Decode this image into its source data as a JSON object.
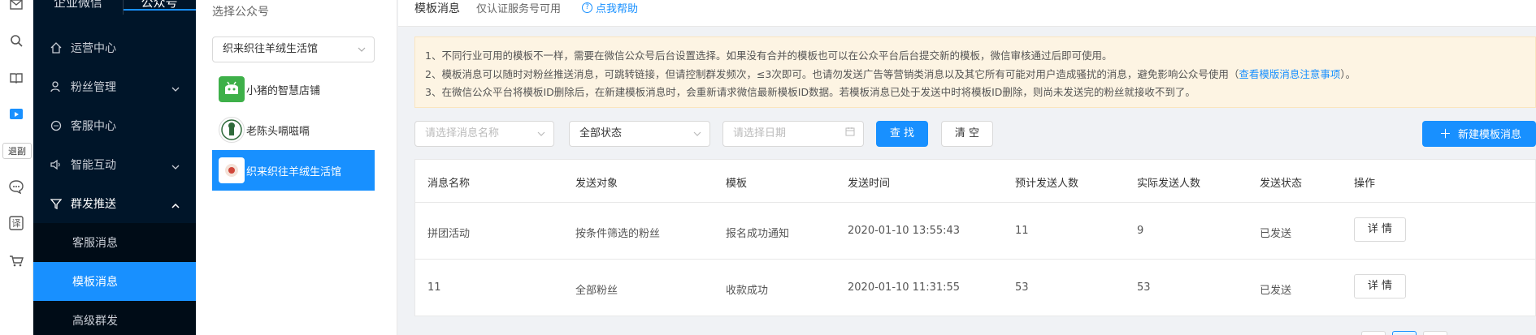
{
  "rail": {
    "icons": [
      "mail-icon",
      "search-icon",
      "book-icon",
      "video-icon",
      "chat-icon",
      "translate-icon",
      "cart-icon"
    ],
    "tag": "退副"
  },
  "nav": {
    "tabs": [
      "企业微信",
      "公众号"
    ],
    "items": [
      {
        "label": "运营中心",
        "icon": "home-icon"
      },
      {
        "label": "粉丝管理",
        "icon": "user-icon"
      },
      {
        "label": "客服中心",
        "icon": "chat-bubble-icon"
      },
      {
        "label": "智能互动",
        "icon": "speaker-icon"
      },
      {
        "label": "群发推送",
        "icon": "filter-icon"
      }
    ],
    "sub_items": [
      "客服消息",
      "模板消息",
      "高级群发"
    ]
  },
  "accounts": {
    "title": "选择公众号",
    "selected": "织来织往羊绒生活馆",
    "list": [
      "小猪的智慧店铺",
      "老陈头嗝嗞嗝",
      "织来织往羊绒生活馆"
    ]
  },
  "header": {
    "title": "模板消息",
    "subtitle": "仅认证服务号可用",
    "help": "点我帮助"
  },
  "notice": {
    "line1": "1、不同行业可用的模板不一样，需要在微信公众号后台设置选择。如果没有合并的模板也可以在公众平台后台提交新的模板，微信审核通过后即可使用。",
    "line2_pre": "2、模板消息可以随时对粉丝推送消息，可跳转链接，但请控制群发频次，≤3次即可。也请勿发送广告等营销类消息以及其它所有可能对用户造成骚扰的消息，避免影响公众号使用（",
    "line2_link": "查看模版消息注意事项",
    "line2_post": "）。",
    "line3": "3、在微信公众平台将模板ID删除后，在新建模板消息时，会重新请求微信最新模板ID数据。若模板消息已处于发送中时将模板ID删除，则尚未发送完的粉丝就接收不到了。"
  },
  "filters": {
    "name_placeholder": "请选择消息名称",
    "status": "全部状态",
    "date_placeholder": "请选择日期",
    "search_btn": "查 找",
    "clear_btn": "清 空",
    "new_btn": "新建模板消息"
  },
  "table": {
    "headers": [
      "消息名称",
      "发送对象",
      "模板",
      "发送时间",
      "预计发送人数",
      "实际发送人数",
      "发送状态",
      "操作"
    ],
    "rows": [
      {
        "name": "拼团活动",
        "target": "按条件筛选的粉丝",
        "template": "报名成功通知",
        "time": "2020-01-10 13:55:43",
        "expected": "11",
        "actual": "9",
        "status": "已发送",
        "action": "详 情"
      },
      {
        "name": "11",
        "target": "全部粉丝",
        "template": "收款成功",
        "time": "2020-01-10 11:31:55",
        "expected": "53",
        "actual": "53",
        "status": "已发送",
        "action": "详 情"
      }
    ]
  },
  "colors": {
    "primary": "#1890ff",
    "nav_bg": "#001529",
    "notice_bg": "#fdf4e3"
  }
}
